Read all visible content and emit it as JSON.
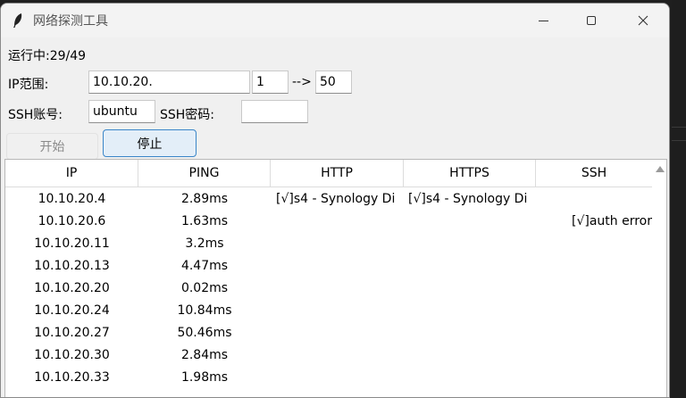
{
  "window": {
    "title": "网络探测工具"
  },
  "status": {
    "text": "运行中:29/49"
  },
  "form": {
    "ip_range_label": "IP范围:",
    "ip_prefix": "10.10.20.",
    "ip_start": "1",
    "range_arrow": "-->",
    "ip_end": "50",
    "ssh_user_label": "SSH账号:",
    "ssh_user": "ubuntu",
    "ssh_pass_label": "SSH密码:",
    "ssh_pass": ""
  },
  "buttons": {
    "start": "开始",
    "stop": "停止"
  },
  "table": {
    "columns": [
      "IP",
      "PING",
      "HTTP",
      "HTTPS",
      "SSH"
    ],
    "rows": [
      [
        "10.10.20.4",
        "2.89ms",
        "[√]s4 - Synology Di",
        "[√]s4 - Synology Di",
        ""
      ],
      [
        "10.10.20.6",
        "1.63ms",
        "",
        "",
        "[√]auth error"
      ],
      [
        "10.10.20.11",
        "3.2ms",
        "",
        "",
        ""
      ],
      [
        "10.10.20.13",
        "4.47ms",
        "",
        "",
        ""
      ],
      [
        "10.10.20.20",
        "0.02ms",
        "",
        "",
        ""
      ],
      [
        "10.10.20.24",
        "10.84ms",
        "",
        "",
        ""
      ],
      [
        "10.10.20.27",
        "50.46ms",
        "",
        "",
        ""
      ],
      [
        "10.10.20.30",
        "2.84ms",
        "",
        "",
        ""
      ],
      [
        "10.10.20.33",
        "1.98ms",
        "",
        "",
        ""
      ]
    ]
  },
  "icons": {
    "app": "feather-icon",
    "minimize": "minimize-icon",
    "maximize": "maximize-icon",
    "close": "close-icon",
    "scroll_up": "scroll-up-arrow-icon"
  }
}
